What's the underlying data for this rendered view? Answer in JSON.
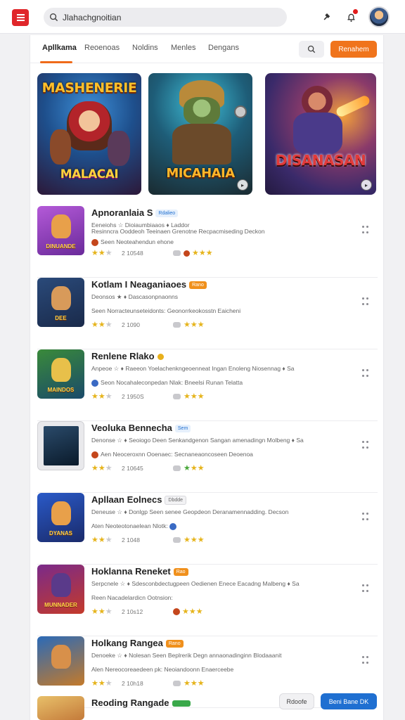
{
  "header": {
    "search_value": "Jlahachgnoitian",
    "search_placeholder": "Search"
  },
  "tabs": [
    {
      "label": "Apllkama"
    },
    {
      "label": "Reoenoas"
    },
    {
      "label": "Noldins"
    },
    {
      "label": "Menles"
    },
    {
      "label": "Dengans"
    }
  ],
  "tab_action_label": "Renahem",
  "banners": [
    {
      "title": "MASHENERIE",
      "subtitle": "MALACAI"
    },
    {
      "title": "",
      "subtitle": "MICAHAIA"
    },
    {
      "title": "",
      "subtitle": "DISANASAN"
    }
  ],
  "apps": [
    {
      "name": "Apnoranlaia S",
      "badge": "Rdalieo",
      "thumb_text": "DINUANDE",
      "line1": "Eeneiohs ☆ Dioiaumbiaaos ♦ Laddor",
      "line2": "Resinncra Ooddeoh Teeinaen Grenotne Recpacmiseding Deckon",
      "dev": "Seen Neoteahendun ehone",
      "rating": 2.5,
      "downloads": "2 10548",
      "rating2": 3
    },
    {
      "name": "Kotlam I Neaganiaoes",
      "badge": "Rano",
      "thumb_text": "DEE",
      "line1": "Deonsos ★ ♦ Dascasonpnaonns",
      "line2": "",
      "dev": "Seen Norracteunseteidonts: Geonorrkeokosstn Eaicheni",
      "rating": 2.5,
      "downloads": "2 1090",
      "rating2": 3
    },
    {
      "name": "Renlene Rlako",
      "badge": "",
      "thumb_text": "MAINDOS",
      "line1": "Anpeoe ☆ ♦ Raeeon Yoelachenkngeoenneat Ingan Enoleng Niosennag ♦ Sa",
      "line2": "",
      "dev": "Seon Nocahaleconpedan Nlak: Bneelsi Runan Telatta",
      "rating": 2.5,
      "downloads": "2 1950S",
      "rating2": 3.5
    },
    {
      "name": "Veoluka Bennecha",
      "badge": "Sem",
      "thumb_text": "",
      "line1": "Denonse ☆ ♦ Seoiogo Deen Senkandgenon Sangan amenadingn Molbeng ♦ Sa",
      "line2": "",
      "dev": "Aen Neoceroxnn Ooenaec: Secnaneaoncoseen Deoenoa",
      "rating": 2,
      "downloads": "2 10645",
      "rating2": 1.5
    },
    {
      "name": "Apllaan Eolnecs",
      "badge": "Dbdde",
      "thumb_text": "DYANAS",
      "line1": "Deneuse ☆ ♦ Donlgp Seen senee Geopdeon Deranamennadding. Decson",
      "line2": "",
      "dev": "Aten Neoteotonaelean Nlotk:",
      "rating": 2.5,
      "downloads": "2 1048",
      "rating2": 3
    },
    {
      "name": "Hoklanna Reneket",
      "badge": "Rao",
      "thumb_text": "MUNNADER",
      "line1": "Serpcnele ☆ ♦ Sdesconbdectugpeen Oedienen Enece Eacadng Malbeng ♦ Sa",
      "line2": "",
      "dev": "Reen Nacadelardicn Ootnsion:",
      "rating": 2.5,
      "downloads": "2 10s12",
      "rating2": 3.5
    },
    {
      "name": "Holkang Rangea",
      "badge": "Rano",
      "thumb_text": "",
      "line1": "Denoeke ☆ ♦ Nolesan Seen Beplrerik Degn annaonadinginn Blodaaanit",
      "line2": "",
      "dev": "Alen Nereocoreaedeen pk: Neoiandoonn Enaerceebe",
      "rating": 2.5,
      "downloads": "2 10h18",
      "rating2": 3.5
    },
    {
      "name": "Reoding Rangade",
      "badge": "",
      "thumb_text": "",
      "line1": "",
      "line2": "",
      "dev": "",
      "rating": 0,
      "downloads": "",
      "rating2": 0
    }
  ],
  "bottom": {
    "secondary_label": "Rdoofe",
    "primary_label": "Beni Bane DK"
  },
  "colors": {
    "accent": "#f0741c",
    "primary": "#1f6fd1",
    "menu": "#e0262a"
  }
}
